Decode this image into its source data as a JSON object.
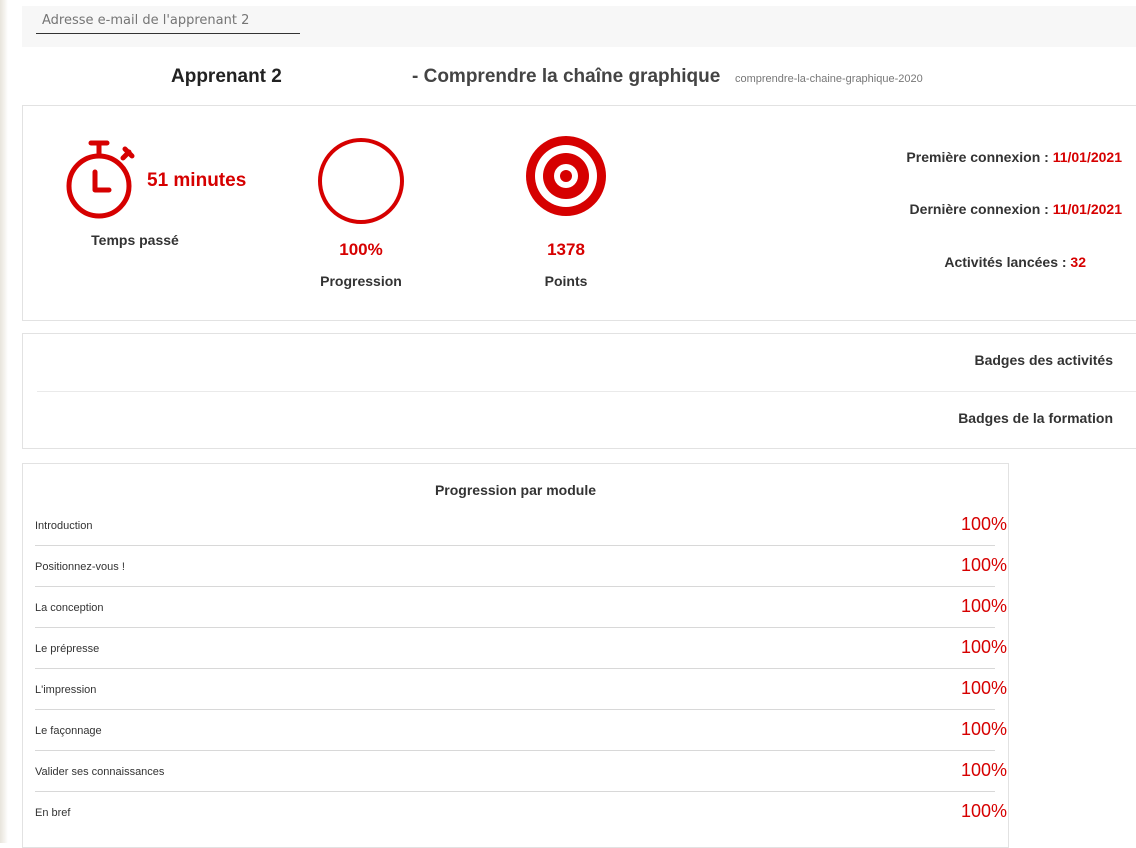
{
  "email": {
    "placeholder": "Adresse e-mail de l'apprenant 2"
  },
  "header": {
    "learner": "Apprenant 2",
    "course_title": "- Comprendre la chaîne graphique",
    "course_slug": "comprendre-la-chaine-graphique-2020"
  },
  "stats": {
    "time_value": "51 minutes",
    "time_label": "Temps passé",
    "progress_value": "100%",
    "progress_label": "Progression",
    "points_value": "1378",
    "points_label": "Points",
    "first_login_label": "Première connexion : ",
    "first_login_value": "11/01/2021",
    "last_login_label": "Dernière connexion : ",
    "last_login_value": "11/01/2021",
    "activities_label": "Activités lancées : ",
    "activities_value": "32"
  },
  "badges": {
    "activities": "Badges des activités",
    "course": "Badges de la formation"
  },
  "modules": {
    "title": "Progression par module",
    "items": [
      {
        "name": "Introduction",
        "pct": "100%"
      },
      {
        "name": "Positionnez-vous !",
        "pct": "100%"
      },
      {
        "name": "La conception",
        "pct": "100%"
      },
      {
        "name": "Le prépresse",
        "pct": "100%"
      },
      {
        "name": "L'impression",
        "pct": "100%"
      },
      {
        "name": "Le façonnage",
        "pct": "100%"
      },
      {
        "name": "Valider ses connaissances",
        "pct": "100%"
      },
      {
        "name": "En bref",
        "pct": "100%"
      }
    ]
  },
  "colors": {
    "accent": "#d60000"
  },
  "icons": [
    "stopwatch-icon",
    "progress-ring-icon",
    "target-icon"
  ]
}
